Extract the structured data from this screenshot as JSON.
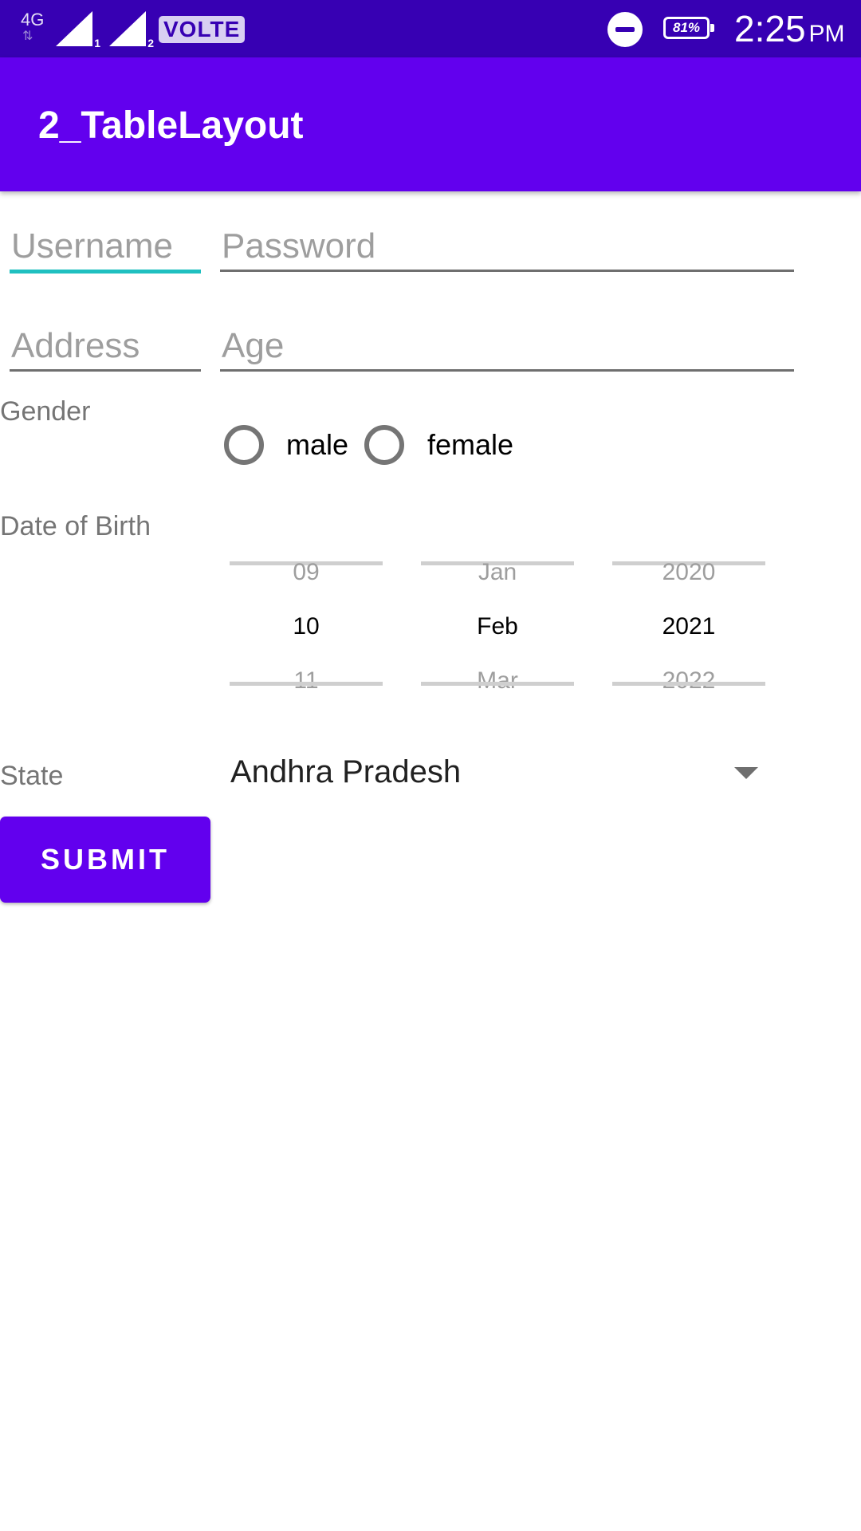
{
  "status_bar": {
    "network": "4G",
    "sim1_index": "1",
    "sim2_index": "2",
    "volte": "VOLTE",
    "icons": [
      "network-activity-icon",
      "signal-icon",
      "signal-icon",
      "dnd-icon",
      "battery-icon"
    ],
    "battery": "81%",
    "time": "2:25",
    "ampm": "PM"
  },
  "app_bar": {
    "title": "2_TableLayout",
    "color": "#6200ee"
  },
  "form": {
    "username": {
      "placeholder": "Username",
      "value": ""
    },
    "password": {
      "placeholder": "Password",
      "value": ""
    },
    "address": {
      "placeholder": "Address",
      "value": ""
    },
    "age": {
      "placeholder": "Age",
      "value": ""
    },
    "gender": {
      "label": "Gender",
      "options": [
        "male",
        "female"
      ],
      "selected": null
    },
    "dob": {
      "label": "Date of Birth",
      "day": {
        "prev": "09",
        "current": "10",
        "next": "11"
      },
      "month": {
        "prev": "Jan",
        "current": "Feb",
        "next": "Mar"
      },
      "year": {
        "prev": "2020",
        "current": "2021",
        "next": "2022"
      }
    },
    "state": {
      "label": "State",
      "selected": "Andhra Pradesh"
    },
    "submit_label": "SUBMIT"
  },
  "colors": {
    "status_bar": "#3700b3",
    "primary": "#6200ee",
    "focus_underline": "#1fc0c0"
  }
}
